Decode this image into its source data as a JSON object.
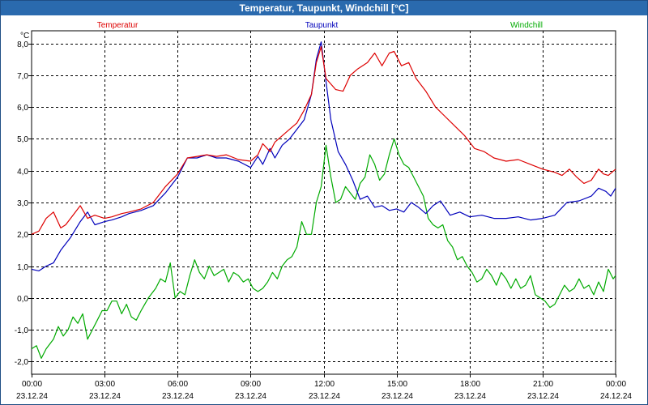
{
  "window": {
    "title": "Temperatur, Taupunkt, Windchill [°C]"
  },
  "chart_data": {
    "type": "line",
    "title": "Temperatur, Taupunkt, Windchill [°C]",
    "ylabel": "°C",
    "ylim": [
      -2.4,
      8.4
    ],
    "y_ticks": [
      -2.0,
      -1.0,
      0.0,
      1.0,
      2.0,
      3.0,
      4.0,
      5.0,
      6.0,
      7.0,
      8.0
    ],
    "y_tick_labels": [
      "-2,0",
      "-1,0",
      "0,0",
      "1,0",
      "2,0",
      "3,0",
      "4,0",
      "5,0",
      "6,0",
      "7,0",
      "8,0"
    ],
    "xlim": [
      0,
      24
    ],
    "x_ticks": [
      0,
      3,
      6,
      9,
      12,
      15,
      18,
      21,
      24
    ],
    "x_tick_times": [
      "00:00",
      "03:00",
      "06:00",
      "09:00",
      "12:00",
      "15:00",
      "18:00",
      "21:00",
      "00:00"
    ],
    "x_tick_dates": [
      "23.12.24",
      "23.12.24",
      "23.12.24",
      "23.12.24",
      "23.12.24",
      "23.12.24",
      "23.12.24",
      "23.12.24",
      "24.12.24"
    ],
    "grid": true,
    "legend_position": "top",
    "series": [
      {
        "name": "Temperatur",
        "color": "#dd0000",
        "x": [
          0,
          0.3,
          0.6,
          0.9,
          1.2,
          1.4,
          1.7,
          2.0,
          2.3,
          2.6,
          3.0,
          3.3,
          3.7,
          4.0,
          4.5,
          5.0,
          5.5,
          6.0,
          6.4,
          6.8,
          7.2,
          7.6,
          8.0,
          8.5,
          9.0,
          9.3,
          9.5,
          9.8,
          10.0,
          10.3,
          10.6,
          10.9,
          11.2,
          11.5,
          11.7,
          11.9,
          12.1,
          12.5,
          12.8,
          13.1,
          13.4,
          13.8,
          14.1,
          14.4,
          14.7,
          14.9,
          15.2,
          15.5,
          15.8,
          16.2,
          16.6,
          17.0,
          17.4,
          17.8,
          18.2,
          18.6,
          19.0,
          19.5,
          20.0,
          20.5,
          21.0,
          21.5,
          21.8,
          22.1,
          22.4,
          22.7,
          23.0,
          23.3,
          23.5,
          23.7,
          24.0
        ],
        "values": [
          2.0,
          2.1,
          2.5,
          2.7,
          2.2,
          2.3,
          2.6,
          2.9,
          2.5,
          2.6,
          2.5,
          2.55,
          2.65,
          2.7,
          2.8,
          3.0,
          3.5,
          3.9,
          4.4,
          4.45,
          4.5,
          4.45,
          4.5,
          4.35,
          4.3,
          4.5,
          4.85,
          4.6,
          4.9,
          5.1,
          5.3,
          5.5,
          5.9,
          6.4,
          7.4,
          7.9,
          6.9,
          6.55,
          6.5,
          7.0,
          7.2,
          7.4,
          7.7,
          7.3,
          7.7,
          7.75,
          7.3,
          7.4,
          6.9,
          6.5,
          6.0,
          5.7,
          5.4,
          5.1,
          4.7,
          4.6,
          4.4,
          4.3,
          4.35,
          4.2,
          4.05,
          3.95,
          3.85,
          4.05,
          3.8,
          3.6,
          3.7,
          4.05,
          3.9,
          3.85,
          4.05
        ]
      },
      {
        "name": "Taupunkt",
        "color": "#0000bb",
        "x": [
          0,
          0.3,
          0.6,
          0.9,
          1.2,
          1.6,
          2.0,
          2.3,
          2.6,
          3.0,
          3.3,
          3.7,
          4.0,
          4.5,
          5.0,
          5.5,
          6.0,
          6.4,
          6.8,
          7.2,
          7.6,
          8.0,
          8.5,
          9.0,
          9.3,
          9.5,
          9.8,
          10.0,
          10.3,
          10.6,
          10.9,
          11.2,
          11.5,
          11.7,
          11.9,
          12.1,
          12.3,
          12.6,
          12.9,
          13.2,
          13.5,
          13.8,
          14.1,
          14.4,
          14.7,
          15.0,
          15.3,
          15.6,
          15.9,
          16.2,
          16.5,
          16.8,
          17.2,
          17.6,
          18.0,
          18.5,
          19.0,
          19.5,
          20.0,
          20.5,
          21.0,
          21.5,
          22.0,
          22.5,
          23.0,
          23.3,
          23.6,
          23.8,
          24.0
        ],
        "values": [
          0.9,
          0.85,
          1.0,
          1.1,
          1.5,
          1.9,
          2.4,
          2.7,
          2.3,
          2.4,
          2.45,
          2.55,
          2.65,
          2.75,
          2.9,
          3.3,
          3.8,
          4.4,
          4.4,
          4.5,
          4.4,
          4.4,
          4.3,
          4.1,
          4.45,
          4.2,
          4.7,
          4.4,
          4.8,
          5.0,
          5.3,
          5.6,
          6.4,
          7.5,
          8.05,
          6.8,
          5.6,
          4.6,
          4.2,
          3.7,
          3.1,
          3.2,
          2.85,
          2.9,
          2.75,
          2.8,
          2.7,
          3.0,
          2.85,
          2.65,
          2.9,
          3.05,
          2.6,
          2.7,
          2.55,
          2.6,
          2.5,
          2.5,
          2.55,
          2.45,
          2.5,
          2.6,
          3.0,
          3.05,
          3.2,
          3.45,
          3.35,
          3.2,
          3.45
        ]
      },
      {
        "name": "Windchill",
        "color": "#00aa00",
        "x": [
          0,
          0.2,
          0.4,
          0.6,
          0.9,
          1.1,
          1.3,
          1.5,
          1.7,
          1.9,
          2.1,
          2.3,
          2.5,
          2.7,
          2.9,
          3.1,
          3.3,
          3.5,
          3.7,
          3.9,
          4.1,
          4.3,
          4.5,
          4.8,
          5.1,
          5.3,
          5.5,
          5.7,
          5.9,
          6.1,
          6.3,
          6.5,
          6.7,
          6.9,
          7.1,
          7.3,
          7.5,
          7.7,
          7.9,
          8.1,
          8.3,
          8.5,
          8.7,
          8.9,
          9.1,
          9.3,
          9.5,
          9.7,
          9.9,
          10.1,
          10.3,
          10.5,
          10.7,
          10.9,
          11.1,
          11.3,
          11.5,
          11.7,
          11.9,
          12.1,
          12.3,
          12.5,
          12.7,
          12.9,
          13.1,
          13.3,
          13.5,
          13.7,
          13.9,
          14.1,
          14.3,
          14.5,
          14.7,
          14.9,
          15.1,
          15.3,
          15.5,
          15.7,
          15.9,
          16.1,
          16.3,
          16.5,
          16.7,
          16.9,
          17.1,
          17.3,
          17.5,
          17.7,
          17.9,
          18.1,
          18.3,
          18.5,
          18.7,
          18.9,
          19.1,
          19.3,
          19.5,
          19.7,
          19.9,
          20.1,
          20.3,
          20.5,
          20.7,
          20.9,
          21.1,
          21.3,
          21.5,
          21.7,
          21.9,
          22.1,
          22.3,
          22.5,
          22.7,
          22.9,
          23.1,
          23.3,
          23.5,
          23.7,
          23.9,
          24.0
        ],
        "values": [
          -1.6,
          -1.5,
          -1.9,
          -1.6,
          -1.3,
          -0.9,
          -1.2,
          -1.0,
          -0.6,
          -0.8,
          -0.5,
          -1.3,
          -1.0,
          -0.7,
          -0.4,
          -0.4,
          -0.1,
          -0.1,
          -0.5,
          -0.2,
          -0.6,
          -0.7,
          -0.4,
          0.0,
          0.3,
          0.6,
          0.5,
          1.1,
          0.0,
          0.2,
          0.1,
          0.7,
          1.2,
          0.8,
          0.6,
          1.0,
          0.7,
          0.8,
          0.9,
          0.5,
          0.8,
          0.7,
          0.5,
          0.6,
          0.3,
          0.2,
          0.3,
          0.5,
          0.8,
          0.6,
          1.0,
          1.2,
          1.3,
          1.6,
          2.4,
          2.0,
          2.0,
          3.0,
          3.5,
          4.8,
          3.8,
          3.0,
          3.1,
          3.5,
          3.3,
          3.1,
          3.6,
          3.8,
          4.5,
          4.2,
          3.7,
          3.9,
          4.5,
          5.0,
          4.5,
          4.2,
          4.1,
          3.8,
          3.5,
          3.2,
          2.5,
          2.3,
          2.2,
          2.3,
          1.8,
          1.6,
          1.2,
          1.3,
          1.0,
          0.8,
          0.5,
          0.6,
          0.9,
          0.7,
          0.4,
          0.8,
          0.6,
          0.3,
          0.6,
          0.3,
          0.4,
          0.7,
          0.1,
          0.0,
          -0.1,
          -0.3,
          -0.2,
          0.1,
          0.4,
          0.2,
          0.3,
          0.6,
          0.3,
          0.4,
          0.1,
          0.5,
          0.2,
          0.9,
          0.6,
          0.7
        ]
      }
    ]
  }
}
